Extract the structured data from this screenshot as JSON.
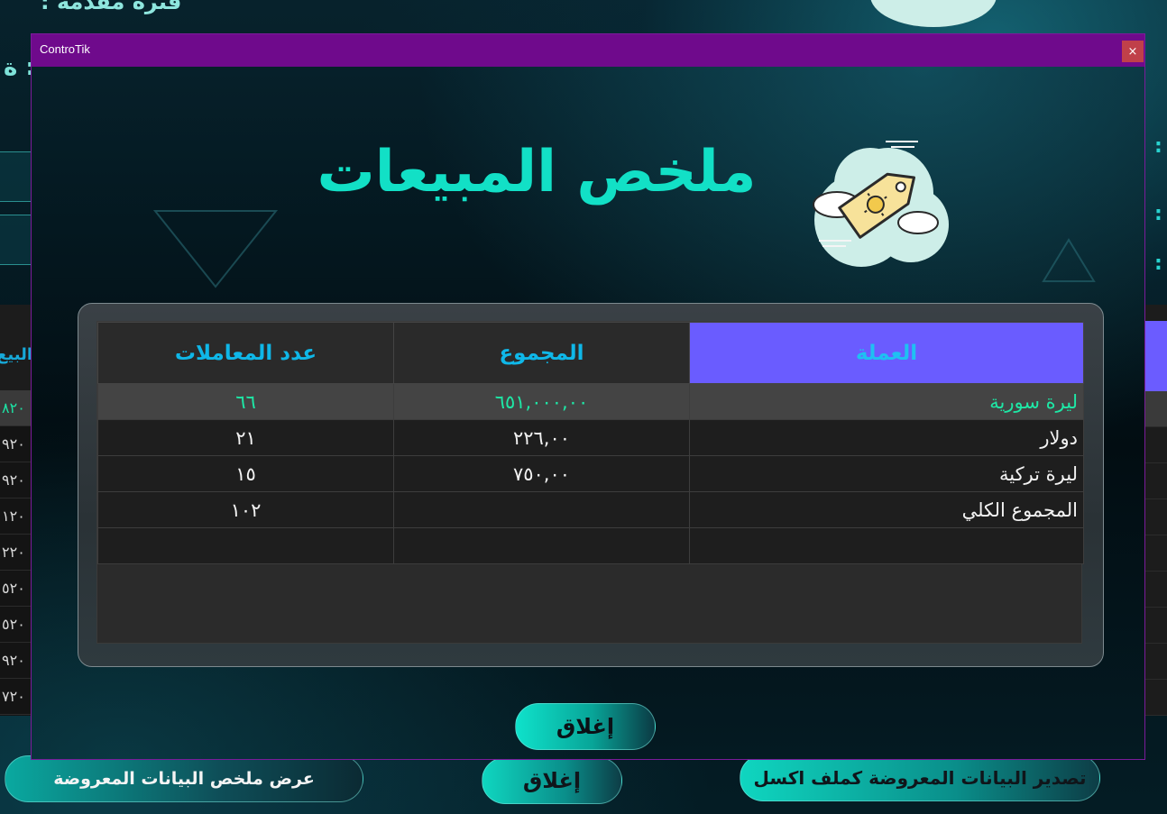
{
  "background": {
    "top_label": "فترة مقدمة :",
    "left_label": "ة :",
    "left_table_header": "البيع",
    "left_table_rows": [
      "٨٢٠",
      "٩٢٠",
      "٩٢٠",
      "١٢٠",
      "٢٢٠",
      "٥٢٠",
      "٥٢٠",
      "٩٢٠",
      "٧٢٠"
    ],
    "buttons": {
      "summary": "عرض ملخص البيانات المعروضة",
      "close": "إغلاق",
      "export": "تصدير البيانات المعروضة كملف اكسل"
    }
  },
  "window": {
    "title": "ControTik",
    "close_glyph": "×"
  },
  "dialog": {
    "heading": "ملخص المبيعات",
    "logo_icon": "price-tag-cloud-icon",
    "close_button": "إغلاق"
  },
  "table": {
    "headers": {
      "currency": "العملة",
      "total": "المجموع",
      "count": "عدد المعاملات"
    },
    "rows": [
      {
        "currency": "ليرة سورية",
        "total": "٦٥١,٠٠٠,٠٠",
        "count": "٦٦"
      },
      {
        "currency": "دولار",
        "total": "٢٢٦,٠٠",
        "count": "٢١"
      },
      {
        "currency": "ليرة تركية",
        "total": "٧٥٠,٠٠",
        "count": "١٥"
      },
      {
        "currency": "المجموع الكلي",
        "total": "",
        "count": "١٠٢"
      },
      {
        "currency": "",
        "total": "",
        "count": ""
      }
    ]
  },
  "colors": {
    "accent_header": "#6a5cff",
    "title_bar": "#6f0a8c",
    "heading_text": "#12e0c6",
    "selected_text": "#1ee8a6"
  }
}
